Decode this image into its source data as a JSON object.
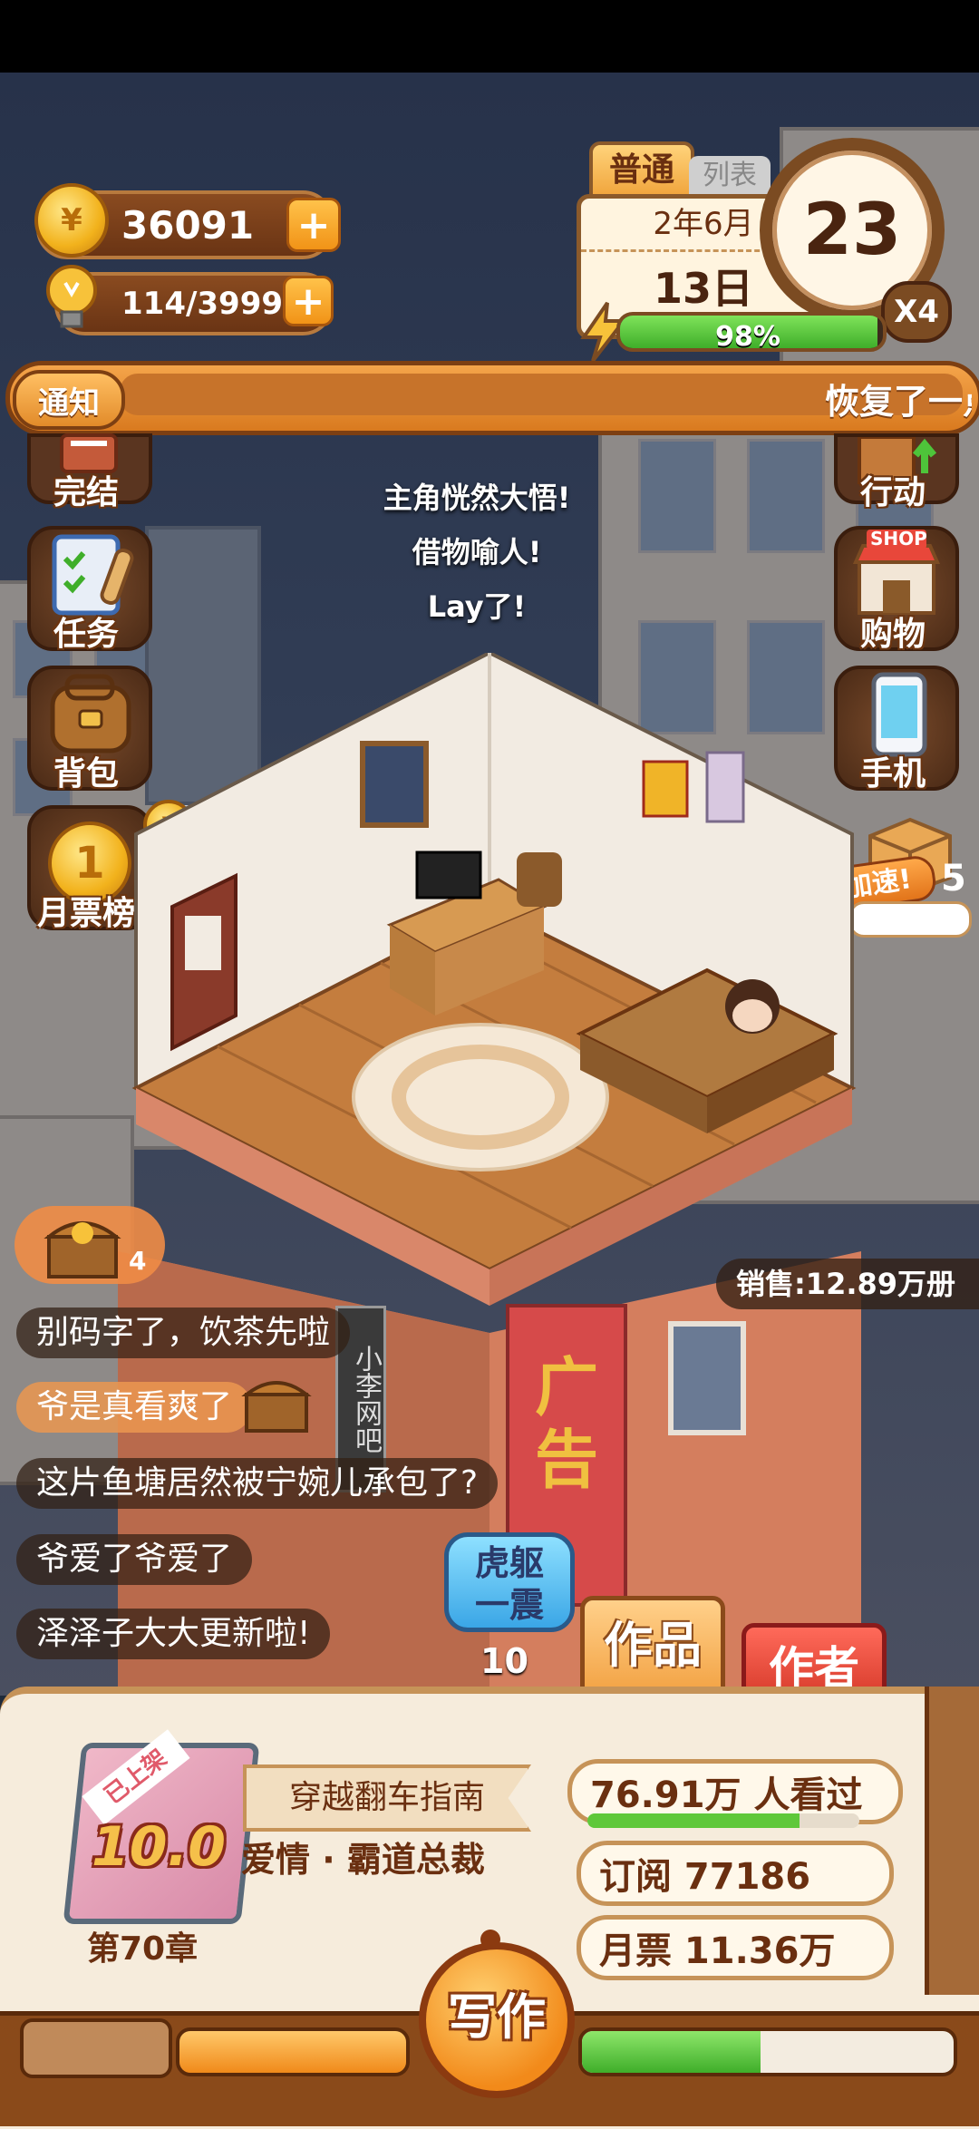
{
  "status_bar": {},
  "currency": {
    "coins": "36091",
    "energy": "114/3999",
    "coin_glyph": "¥"
  },
  "calendar": {
    "mode": "普通",
    "mode_shadow": "列表",
    "year_month": "2年6月",
    "day": "13日",
    "day_number": "23",
    "speed": "X4",
    "progress_label": "98%",
    "progress": 0.98
  },
  "notice": {
    "tag": "通知",
    "text": "恢复了一点"
  },
  "left_menu": [
    {
      "label": "完结",
      "icon": "book-icon"
    },
    {
      "label": "任务",
      "icon": "clipboard-icon"
    },
    {
      "label": "背包",
      "icon": "backpack-icon"
    },
    {
      "label": "月票榜",
      "icon": "medal-icon"
    }
  ],
  "medal_badge": "1",
  "ticket_counter": "0",
  "right_menu": [
    {
      "label": "行动",
      "icon": "door-icon"
    },
    {
      "label": "购物",
      "icon": "shop-icon",
      "sign": "SHOP"
    },
    {
      "label": "手机",
      "icon": "phone-icon"
    }
  ],
  "speedup": {
    "label": "加速!",
    "count": "5"
  },
  "float_messages": [
    "主角恍然大悟!",
    "借物喻人!",
    "Lay了!"
  ],
  "treasure_count": "4",
  "sales": "销售:12.89万册",
  "chat": [
    {
      "text": "别码字了，饮茶先啦",
      "highlight": false
    },
    {
      "text": "爷是真看爽了",
      "highlight": true
    },
    {
      "text": "这片鱼塘居然被宁婉儿承包了?",
      "highlight": false
    },
    {
      "text": "爷爱了爷爱了",
      "highlight": false
    },
    {
      "text": "泽泽子大大更新啦!",
      "highlight": false
    }
  ],
  "shake_button": {
    "label_line1": "虎躯",
    "label_line2": "一震",
    "count": "10"
  },
  "tabs": {
    "works": "作品",
    "author": "作者"
  },
  "building_signs": {
    "ad": "广告",
    "cafe": "小李网吧"
  },
  "book": {
    "status_ribbon": "已上架",
    "score": "10.0",
    "chapter": "第70章",
    "title": "穿越翻车指南",
    "genre": "爱情 · 霸道总裁",
    "views": "76.91万 人看过",
    "views_progress": 0.78,
    "subscriptions": "订阅 77186",
    "monthly_tickets": "月票 11.36万"
  },
  "write_button": "写作",
  "bottom_bars": {
    "left_progress": 1.0,
    "right_progress": 0.48
  }
}
